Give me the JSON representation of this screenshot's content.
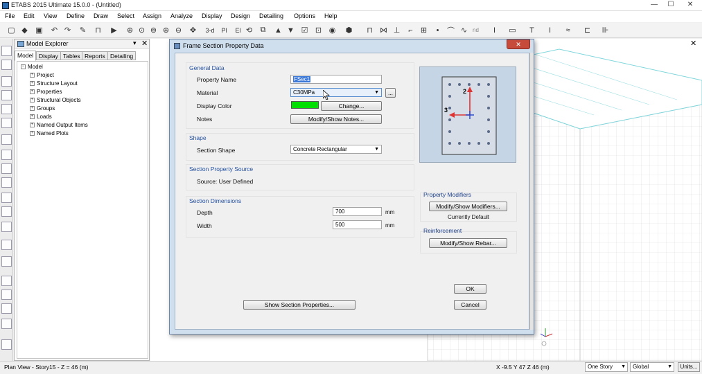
{
  "window": {
    "title": "ETABS 2015 Ultimate 15.0.0 - (Untitled)",
    "minimize": "—",
    "maximize": "☐",
    "close": "✕"
  },
  "menu": {
    "items": [
      "File",
      "Edit",
      "View",
      "Define",
      "Draw",
      "Select",
      "Assign",
      "Analyze",
      "Display",
      "Design",
      "Detailing",
      "Options",
      "Help"
    ]
  },
  "toolbar": {
    "view_3d": "3-d",
    "plan_label": "Pl",
    "elev_label": "El",
    "nd_label": "nd"
  },
  "explorer": {
    "title": "Model Explorer",
    "tabs": [
      "Model",
      "Display",
      "Tables",
      "Reports",
      "Detailing"
    ],
    "root": "Model",
    "nodes": [
      "Project",
      "Structure Layout",
      "Properties",
      "Structural Objects",
      "Groups",
      "Loads",
      "Named Output Items",
      "Named Plots"
    ]
  },
  "statusbar": {
    "view_info": "Plan View - Story15 - Z = 46 (m)",
    "coords": "X -9.5  Y 47  Z 46 (m)",
    "story_select": "One Story",
    "coord_system": "Global",
    "units_button": "Units..."
  },
  "dialog": {
    "title": "Frame Section Property Data",
    "close": "✕",
    "general": {
      "header": "General Data",
      "property_name_label": "Property Name",
      "property_name_value": "FSec1",
      "material_label": "Material",
      "material_value": "C30MPa",
      "material_button": "...",
      "display_color_label": "Display Color",
      "display_color": "#00e000",
      "change_button": "Change...",
      "notes_label": "Notes",
      "notes_button": "Modify/Show Notes..."
    },
    "shape": {
      "header": "Shape",
      "section_shape_label": "Section Shape",
      "section_shape_value": "Concrete Rectangular"
    },
    "source": {
      "header": "Section Property Source",
      "source_text": "Source:  User Defined"
    },
    "dimensions": {
      "header": "Section Dimensions",
      "depth_label": "Depth",
      "depth_value": "700",
      "width_label": "Width",
      "width_value": "500",
      "unit": "mm"
    },
    "preview": {
      "axis_2": "2",
      "axis_3": "3"
    },
    "modifiers": {
      "header": "Property Modifiers",
      "button": "Modify/Show Modifiers...",
      "status": "Currently Default"
    },
    "reinforcement": {
      "header": "Reinforcement",
      "button": "Modify/Show Rebar..."
    },
    "show_props_button": "Show Section Properties...",
    "ok_button": "OK",
    "cancel_button": "Cancel"
  }
}
